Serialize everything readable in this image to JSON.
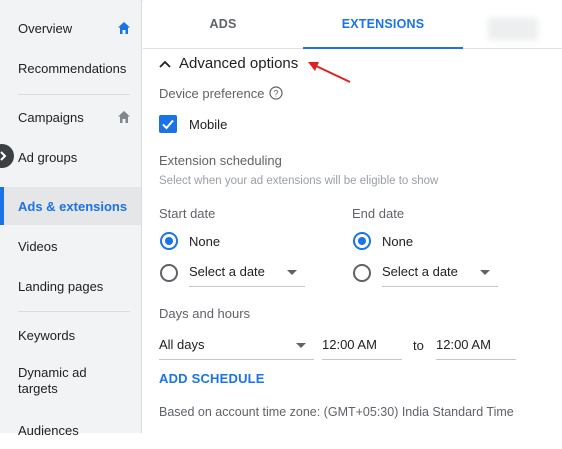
{
  "sidebar": {
    "items": [
      {
        "label": "Overview",
        "icon": "home-icon",
        "active": false
      },
      {
        "label": "Recommendations",
        "active": false
      },
      {
        "label": "Campaigns",
        "icon": "home-icon",
        "active": false
      },
      {
        "label": "Ad groups",
        "active": false
      },
      {
        "label": "Ads & extensions",
        "active": true
      },
      {
        "label": "Videos",
        "active": false
      },
      {
        "label": "Landing pages",
        "active": false
      },
      {
        "label": "Keywords",
        "active": false
      },
      {
        "label": "Dynamic ad targets",
        "active": false
      },
      {
        "label": "Audiences",
        "active": false
      }
    ]
  },
  "tabs": [
    {
      "label": "ADS",
      "active": false
    },
    {
      "label": "EXTENSIONS",
      "active": true
    }
  ],
  "advanced": {
    "title": "Advanced options",
    "device_label": "Device preference",
    "mobile_label": "Mobile",
    "mobile_checked": true,
    "scheduling_label": "Extension scheduling",
    "scheduling_hint": "Select when your ad extensions will be eligible to show",
    "start_date_label": "Start date",
    "end_date_label": "End date",
    "start_none": "None",
    "start_select": "Select a date",
    "end_none": "None",
    "end_select": "Select a date",
    "days_hours_label": "Days and hours",
    "days_value": "All days",
    "from_time": "12:00 AM",
    "to_label": "to",
    "to_time": "12:00 AM",
    "add_schedule": "ADD SCHEDULE",
    "timezone_text": "Based on account time zone: (GMT+05:30) India Standard Time"
  },
  "colors": {
    "accent": "#1a73e8",
    "annotation_arrow": "#e02020"
  }
}
